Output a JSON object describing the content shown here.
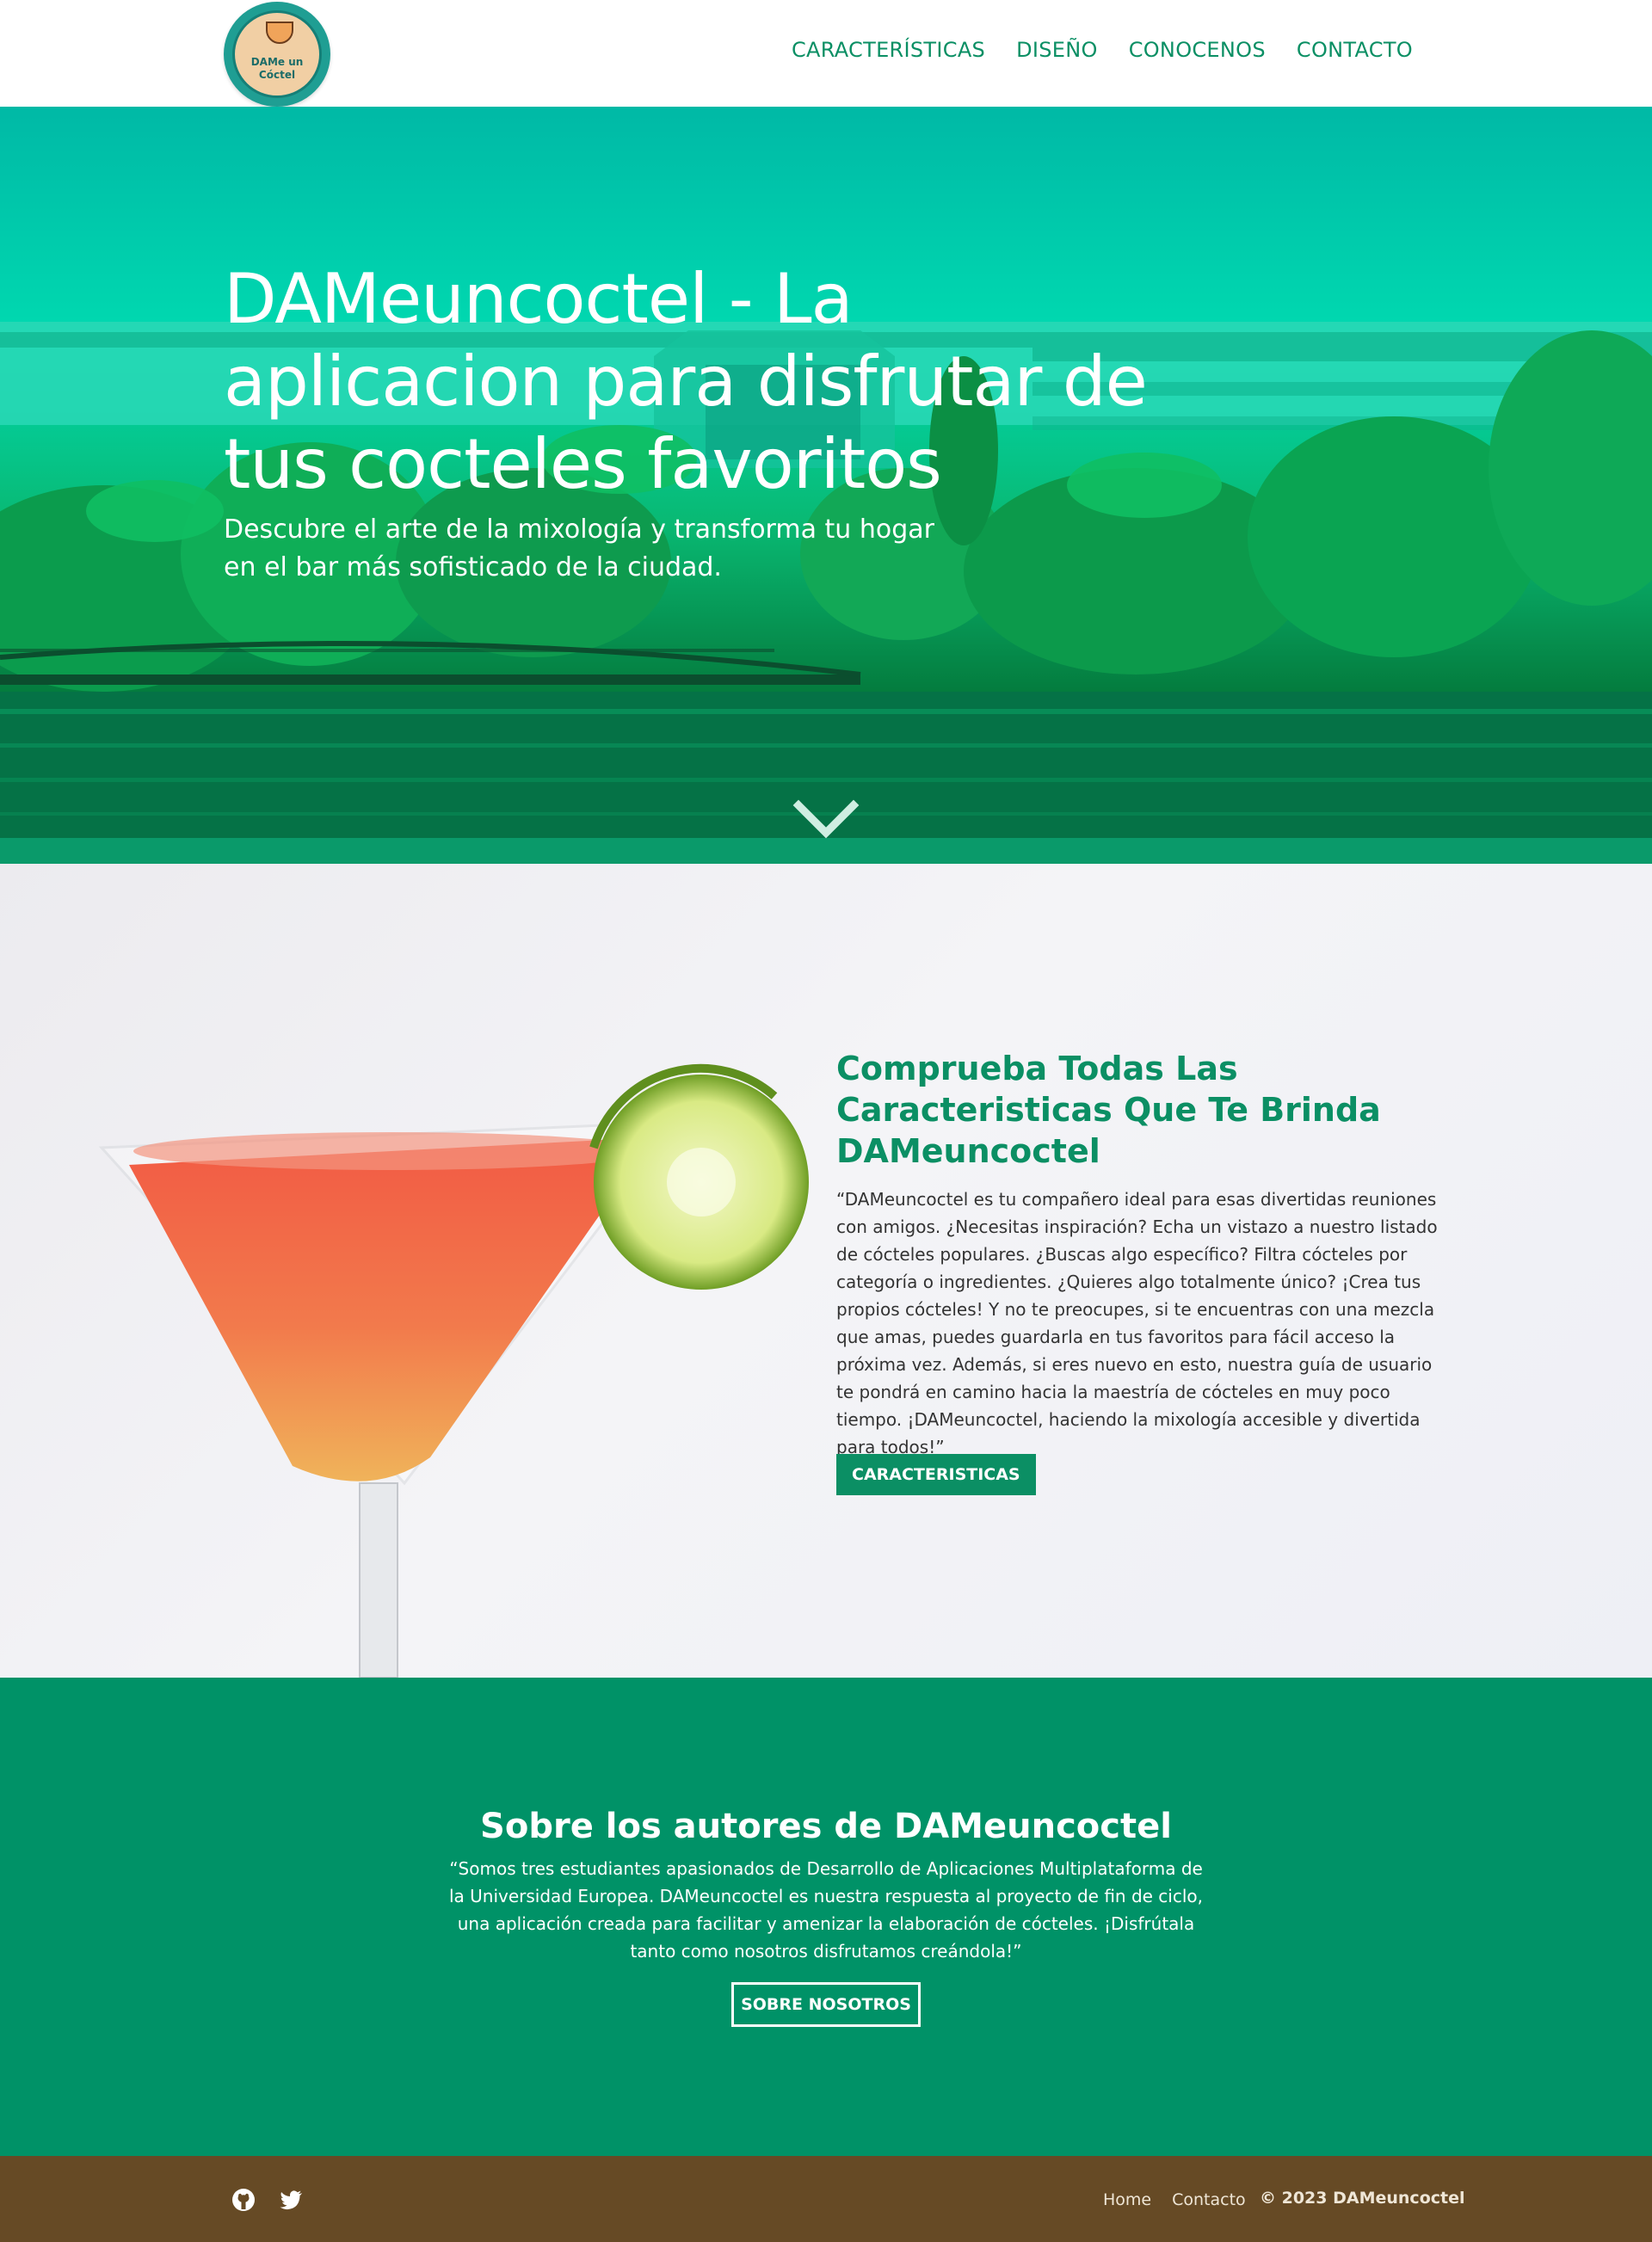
{
  "header": {
    "logo_text_line1": "DAMe un",
    "logo_text_line2": "Cóctel",
    "nav": [
      "CARACTERÍSTICAS",
      "DISEÑO",
      "CONOCENOS",
      "CONTACTO"
    ]
  },
  "hero": {
    "title": "DAMeuncoctel - La aplicacion para disfrutar de tus cocteles favoritos",
    "subtitle": "Descubre el arte de la mixología y transforma tu hogar en el bar más sofisticado de la ciudad.",
    "scroll_icon": "chevron-down-icon"
  },
  "features": {
    "title": "Comprueba Todas Las Caracteristicas Que Te Brinda DAMeuncoctel",
    "body": "“DAMeuncoctel es tu compañero ideal para esas divertidas reuniones con amigos. ¿Necesitas inspiración? Echa un vistazo a nuestro listado de cócteles populares. ¿Buscas algo específico? Filtra cócteles por categoría o ingredientes. ¿Quieres algo totalmente único? ¡Crea tus propios cócteles! Y no te preocupes, si te encuentras con una mezcla que amas, puedes guardarla en tus favoritos para fácil acceso la próxima vez. Además, si eres nuevo en esto, nuestra guía de usuario te pondrá en camino hacia la maestría de cócteles en muy poco tiempo. ¡DAMeuncoctel, haciendo la mixología accesible y divertida para todos!”",
    "button": "CARACTERISTICAS"
  },
  "about": {
    "title": "Sobre los autores de DAMeuncoctel",
    "body": "“Somos tres estudiantes apasionados de Desarrollo de Aplicaciones Multiplataforma de la Universidad Europea. DAMeuncoctel es nuestra respuesta al proyecto de fin de ciclo, una aplicación creada para facilitar y amenizar la elaboración de cócteles. ¡Disfrútala tanto como nosotros disfrutamos creándola!”",
    "button": "SOBRE NOSOTROS"
  },
  "footer": {
    "social_icons": [
      "github-icon",
      "twitter-icon"
    ],
    "links": [
      "Home",
      "Contacto"
    ],
    "copyright": "© 2023 DAMeuncoctel"
  },
  "colors": {
    "brand_green": "#0b8f64",
    "about_bg": "#009267",
    "footer_bg": "#664a25"
  }
}
